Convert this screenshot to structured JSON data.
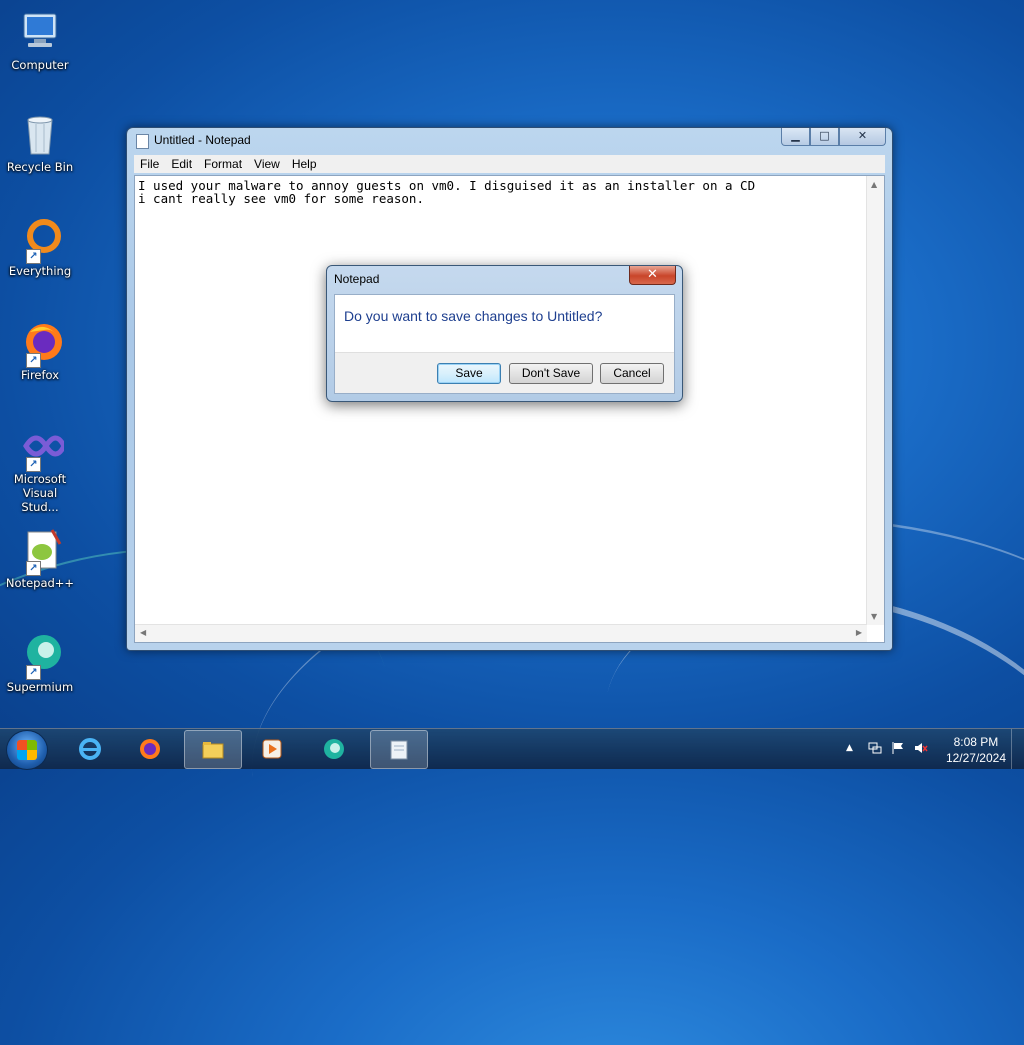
{
  "desktop": {
    "icons": [
      {
        "label": "Computer"
      },
      {
        "label": "Recycle Bin"
      },
      {
        "label": "Everything"
      },
      {
        "label": "Firefox"
      },
      {
        "label": "Microsoft Visual Stud..."
      },
      {
        "label": "Notepad++"
      },
      {
        "label": "Supermium"
      }
    ]
  },
  "notepad": {
    "title": "Untitled - Notepad",
    "controls": {
      "minimize": "▁",
      "maximize": "□",
      "close": "✕"
    },
    "menu": [
      "File",
      "Edit",
      "Format",
      "View",
      "Help"
    ],
    "lines": [
      "I used your malware to annoy guests on vm0. I disguised it as an installer on a CD",
      "i cant really see vm0 for some reason."
    ]
  },
  "dialog": {
    "title": "Notepad",
    "close": "✕",
    "message": "Do you want to save changes to Untitled?",
    "buttons": {
      "save": "Save",
      "dont_save": "Don't Save",
      "cancel": "Cancel"
    }
  },
  "taskbar": {
    "apps": [
      "Internet Explorer",
      "Firefox",
      "Windows Explorer",
      "Media Player",
      "Supermium",
      "Notepad"
    ],
    "tray": {
      "show_hidden": "▲"
    },
    "clock": {
      "time": "8:08 PM",
      "date": "12/27/2024"
    }
  },
  "colors": {
    "accent": "#1e3f8f",
    "desktop": "#1a6cc7"
  }
}
